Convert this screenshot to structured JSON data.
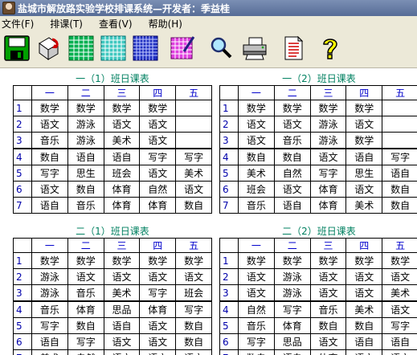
{
  "window": {
    "title": "盐城市解放路实验学校排课系统—开发者：季益桂"
  },
  "menu": [
    "文件(F)",
    "排课(T)",
    "查看(V)",
    "帮助(H)"
  ],
  "toolbar": [
    {
      "name": "save-icon"
    },
    {
      "name": "undo-arrange-icon"
    },
    {
      "name": "green-grid-icon"
    },
    {
      "name": "teal-grid-icon"
    },
    {
      "name": "blue-grid-icon"
    },
    {
      "name": "edit-grid-icon"
    },
    {
      "name": "search-icon"
    },
    {
      "name": "printer-icon"
    },
    {
      "name": "report-icon"
    },
    {
      "name": "help-icon"
    }
  ],
  "days": [
    "一",
    "二",
    "三",
    "四",
    "五"
  ],
  "schedules": [
    {
      "title": "一（1）班日课表",
      "rows": [
        [
          "数学",
          "数学",
          "数学",
          "数学",
          ""
        ],
        [
          "语文",
          "游泳",
          "语文",
          "语文",
          ""
        ],
        [
          "音乐",
          "游泳",
          "美术",
          "语文",
          ""
        ],
        [
          "数自",
          "语自",
          "语自",
          "写字",
          "写字"
        ],
        [
          "写字",
          "思生",
          "班会",
          "语文",
          "美术"
        ],
        [
          "语文",
          "数自",
          "体育",
          "自然",
          "语文"
        ],
        [
          "语自",
          "音乐",
          "体育",
          "体育",
          "数自"
        ]
      ]
    },
    {
      "title": "一（2）班日课表",
      "rows": [
        [
          "数学",
          "数学",
          "数学",
          "数学",
          ""
        ],
        [
          "语文",
          "语文",
          "游泳",
          "语文",
          ""
        ],
        [
          "语文",
          "音乐",
          "游泳",
          "数学",
          ""
        ],
        [
          "数自",
          "数自",
          "语文",
          "语自",
          "写字"
        ],
        [
          "美术",
          "自然",
          "写字",
          "思生",
          "语自"
        ],
        [
          "班会",
          "语文",
          "体育",
          "语文",
          "数自"
        ],
        [
          "音乐",
          "语自",
          "体育",
          "美术",
          "数自"
        ]
      ]
    },
    {
      "title": "二（1）班日课表",
      "rows": [
        [
          "数学",
          "数学",
          "数学",
          "数学",
          "数学"
        ],
        [
          "游泳",
          "语文",
          "语文",
          "语文",
          "语文"
        ],
        [
          "游泳",
          "音乐",
          "美术",
          "写字",
          "班会"
        ],
        [
          "音乐",
          "体育",
          "思品",
          "体育",
          "写字"
        ],
        [
          "写字",
          "数自",
          "语自",
          "语文",
          "数自"
        ],
        [
          "语自",
          "写字",
          "语文",
          "语文",
          "数自"
        ],
        [
          "美术",
          "自然",
          "语文",
          "语文",
          "语文"
        ]
      ]
    },
    {
      "title": "二（2）班日课表",
      "rows": [
        [
          "数学",
          "数学",
          "数学",
          "数学",
          "数学"
        ],
        [
          "语文",
          "游泳",
          "语文",
          "语文",
          "语文"
        ],
        [
          "语文",
          "游泳",
          "语文",
          "语文",
          "美术"
        ],
        [
          "自然",
          "写字",
          "音乐",
          "美术",
          "语文"
        ],
        [
          "音乐",
          "体育",
          "数自",
          "数自",
          "写字"
        ],
        [
          "写字",
          "思品",
          "语文",
          "语自",
          "语自"
        ],
        [
          "数自",
          "语自",
          "体育",
          "语文",
          "语文"
        ]
      ]
    }
  ]
}
